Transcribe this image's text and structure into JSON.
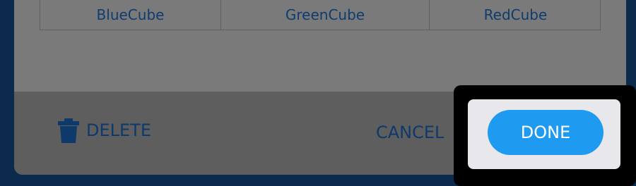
{
  "table": {
    "row": [
      "BlueCube",
      "GreenCube",
      "RedCube"
    ]
  },
  "footer": {
    "delete_label": "DELETE",
    "cancel_label": "CANCEL",
    "done_label": "DONE"
  },
  "icons": {
    "delete": "trash-icon"
  },
  "colors": {
    "primary": "#1e9af0",
    "link": "#0d3a6a",
    "overlay": "#5e5e5e",
    "highlight": "#000000"
  }
}
